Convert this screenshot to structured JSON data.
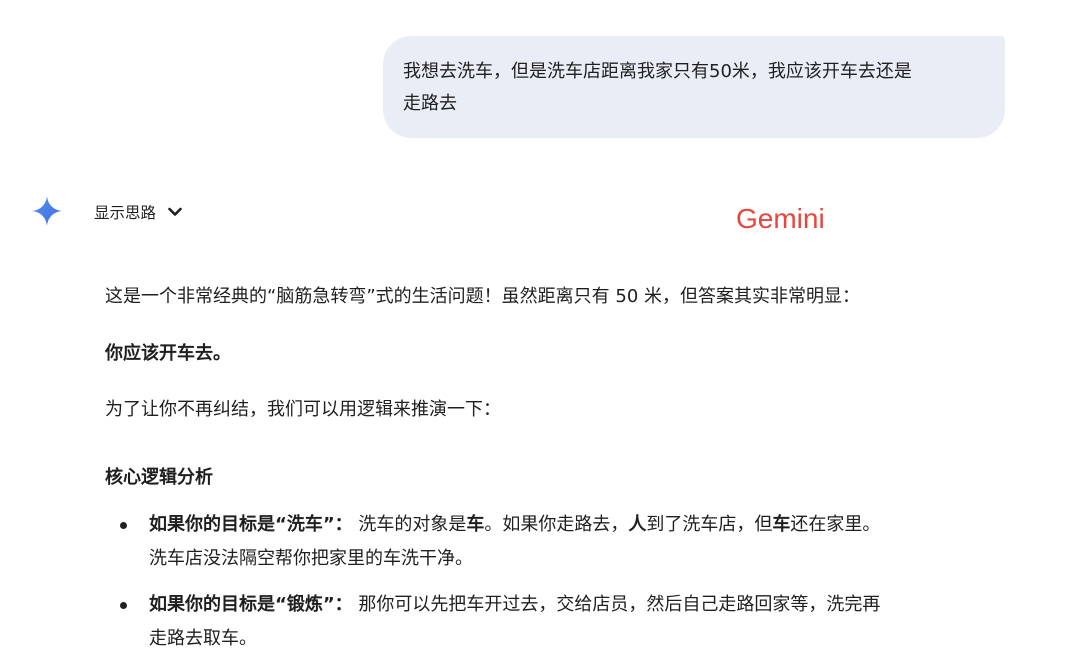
{
  "user_message": {
    "line1": "我想去洗车，但是洗车店距离我家只有50米，我应该开车去还是",
    "line2": "走路去"
  },
  "thinking_toggle": {
    "label": "显示思路",
    "icon": "chevron-down-icon"
  },
  "assistant_icon": "gemini-sparkle-icon",
  "brand_overlay": "Gemini",
  "colors": {
    "user_bubble": "#e9eef6",
    "gemini_blue": "#4285f4",
    "brand_red": "#e8453c",
    "text": "#1f1f1f"
  },
  "response": {
    "intro": "这是一个非常经典的“脑筋急转弯”式的生活问题！虽然距离只有 50 米，但答案其实非常明显：",
    "answer": "你应该开车去。",
    "lead": "为了让你不再纠结，我们可以用逻辑来推演一下：",
    "heading": "核心逻辑分析",
    "bullets": [
      {
        "title": "如果你的目标是“洗车”：",
        "t1": " 洗车的对象是",
        "b1": "车",
        "t2": "。如果你走路去，",
        "b2": "人",
        "t3": "到了洗车店，但",
        "b3": "车",
        "t4": "还在家里。",
        "line2": "洗车店没法隔空帮你把家里的车洗干净。"
      },
      {
        "title": "如果你的目标是“锻炼”：",
        "t1": " 那你可以先把车开过去，交给店员，然后自己走路回家等，洗完再",
        "line2": "走路去取车。"
      }
    ]
  }
}
